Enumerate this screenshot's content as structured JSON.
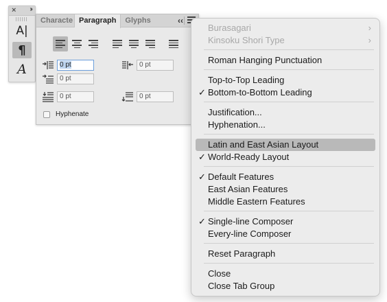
{
  "tools": {
    "close_glyph": "×",
    "expand_glyph": "››",
    "character_tool_glyph": "A|",
    "paragraph_tool_glyph": "¶",
    "glyphs_tool_glyph": "A"
  },
  "panel": {
    "tabs": [
      {
        "label": "Characte",
        "active": false
      },
      {
        "label": "Paragraph",
        "active": true
      },
      {
        "label": "Glyphs",
        "active": false
      }
    ],
    "collapse_glyph": "‹‹",
    "fields": {
      "left_indent": "0 pt",
      "right_indent": "0 pt",
      "first_line_indent": "0 pt",
      "space_before": "0 pt",
      "space_after": "0 pt"
    },
    "hyphenate_label": "Hyphenate",
    "hyphenate_checked": false
  },
  "menu": {
    "items": [
      {
        "label": "Burasagari",
        "disabled": true,
        "submenu": true,
        "checked": false
      },
      {
        "label": "Kinsoku Shori Type",
        "disabled": true,
        "submenu": true,
        "checked": false
      },
      {
        "label": "Roman Hanging Punctuation",
        "disabled": false,
        "checked": false
      },
      {
        "label": "Top-to-Top Leading",
        "disabled": false,
        "checked": false
      },
      {
        "label": "Bottom-to-Bottom Leading",
        "disabled": false,
        "checked": true
      },
      {
        "label": "Justification...",
        "disabled": false,
        "checked": false
      },
      {
        "label": "Hyphenation...",
        "disabled": false,
        "checked": false
      },
      {
        "label": "Latin and East Asian Layout",
        "disabled": false,
        "checked": false,
        "highlighted": true
      },
      {
        "label": "World-Ready Layout",
        "disabled": false,
        "checked": true
      },
      {
        "label": "Default Features",
        "disabled": false,
        "checked": true
      },
      {
        "label": "East Asian Features",
        "disabled": false,
        "checked": false
      },
      {
        "label": "Middle Eastern Features",
        "disabled": false,
        "checked": false
      },
      {
        "label": "Single-line Composer",
        "disabled": false,
        "checked": true
      },
      {
        "label": "Every-line Composer",
        "disabled": false,
        "checked": false
      },
      {
        "label": "Reset Paragraph",
        "disabled": false,
        "checked": false
      },
      {
        "label": "Close",
        "disabled": false,
        "checked": false
      },
      {
        "label": "Close Tab Group",
        "disabled": false,
        "checked": false
      }
    ],
    "check_glyph": "✓",
    "submenu_glyph": "›"
  }
}
